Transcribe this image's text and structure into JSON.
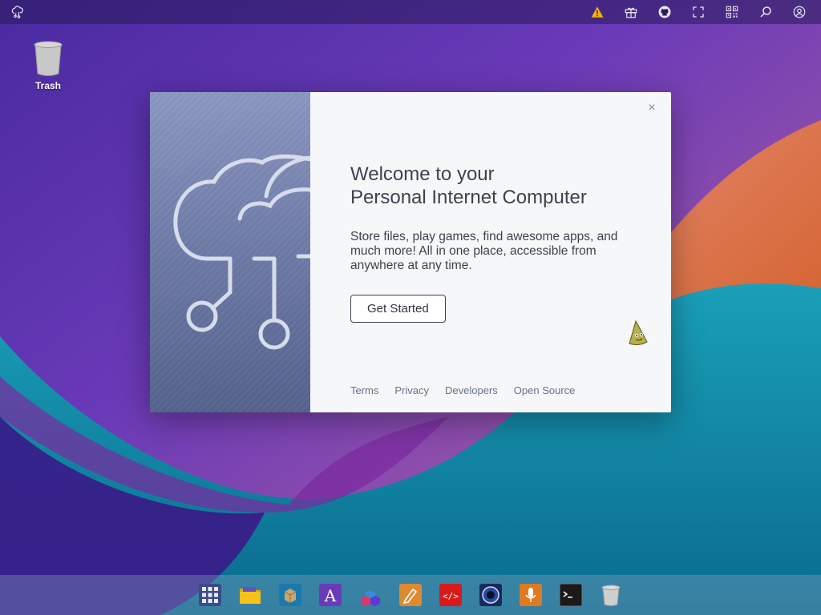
{
  "desktop": {
    "items": [
      {
        "label": "Trash",
        "icon": "trash-icon"
      }
    ]
  },
  "topbar": {
    "left_icon": "puter-logo-icon",
    "right_icons": [
      "warning-icon",
      "gift-icon",
      "github-icon",
      "fullscreen-icon",
      "qr-code-icon",
      "search-icon",
      "user-icon"
    ],
    "warning_color": "#f0b400"
  },
  "dialog": {
    "title_line1": "Welcome to your",
    "title_line2": "Personal Internet Computer",
    "description": "Store files, play games, find awesome apps, and much more! All in one place, accessible from anywhere at any time.",
    "cta_label": "Get Started",
    "close_label": "×",
    "links": [
      "Terms",
      "Privacy",
      "Developers",
      "Open Source"
    ]
  },
  "dock": {
    "items": [
      "apps-grid-icon",
      "files-icon",
      "app-store-icon",
      "editor-icon",
      "blocks-icon",
      "draw-icon",
      "dev-center-icon",
      "camera-icon",
      "recorder-icon",
      "terminal-icon",
      "trash-icon"
    ]
  },
  "colors": {
    "accent": "#3c4250",
    "dialog_bg": "#f6f7f9",
    "topbar_bg": "#2a1a5c"
  }
}
